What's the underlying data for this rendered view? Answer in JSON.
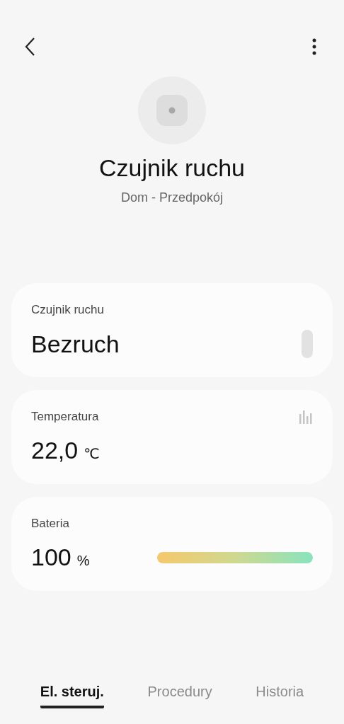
{
  "device": {
    "name": "Czujnik ruchu",
    "location": "Dom - Przedpokój"
  },
  "cards": [
    {
      "kind": "status",
      "label": "Czujnik ruchu",
      "value": "Bezruch"
    },
    {
      "kind": "temperature",
      "label": "Temperatura",
      "value": "22,0",
      "unit": "℃"
    },
    {
      "kind": "battery",
      "label": "Bateria",
      "value": "100",
      "unit": "%",
      "level": 1
    }
  ],
  "tabs": [
    {
      "label": "El. steruj.",
      "selected": true
    },
    {
      "label": "Procedury",
      "selected": false
    },
    {
      "label": "Historia",
      "selected": false
    }
  ]
}
